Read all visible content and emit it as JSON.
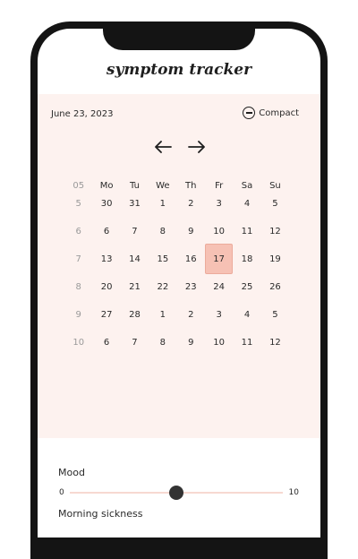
{
  "app": {
    "title": "symptom tracker"
  },
  "calendar": {
    "date_label": "June 23, 2023",
    "compact_label": "Compact",
    "compact_icon": "minus-circle-icon",
    "prev_icon": "arrow-left-icon",
    "next_icon": "arrow-right-icon",
    "week_header": "05",
    "day_names": [
      "Mo",
      "Tu",
      "We",
      "Th",
      "Fr",
      "Sa",
      "Su"
    ],
    "weeks": [
      {
        "num": "5",
        "days": [
          "30",
          "31",
          "1",
          "2",
          "3",
          "4",
          "5"
        ]
      },
      {
        "num": "6",
        "days": [
          "6",
          "7",
          "8",
          "9",
          "10",
          "11",
          "12"
        ]
      },
      {
        "num": "7",
        "days": [
          "13",
          "14",
          "15",
          "16",
          "17",
          "18",
          "19"
        ]
      },
      {
        "num": "8",
        "days": [
          "20",
          "21",
          "22",
          "23",
          "24",
          "25",
          "26"
        ]
      },
      {
        "num": "9",
        "days": [
          "27",
          "28",
          "1",
          "2",
          "3",
          "4",
          "5"
        ]
      },
      {
        "num": "10",
        "days": [
          "6",
          "7",
          "8",
          "9",
          "10",
          "11",
          "12"
        ]
      }
    ],
    "selected": {
      "week": 2,
      "day": 4
    },
    "colors": {
      "panel": "#fdf2ef",
      "selected": "#f6c1b4"
    }
  },
  "mood": {
    "label": "Mood",
    "min": "0",
    "max": "10",
    "value": 5,
    "colors": {
      "track": "#f7d9d1",
      "thumb": "#333333"
    }
  },
  "morning_sickness": {
    "label": "Morning sickness"
  }
}
